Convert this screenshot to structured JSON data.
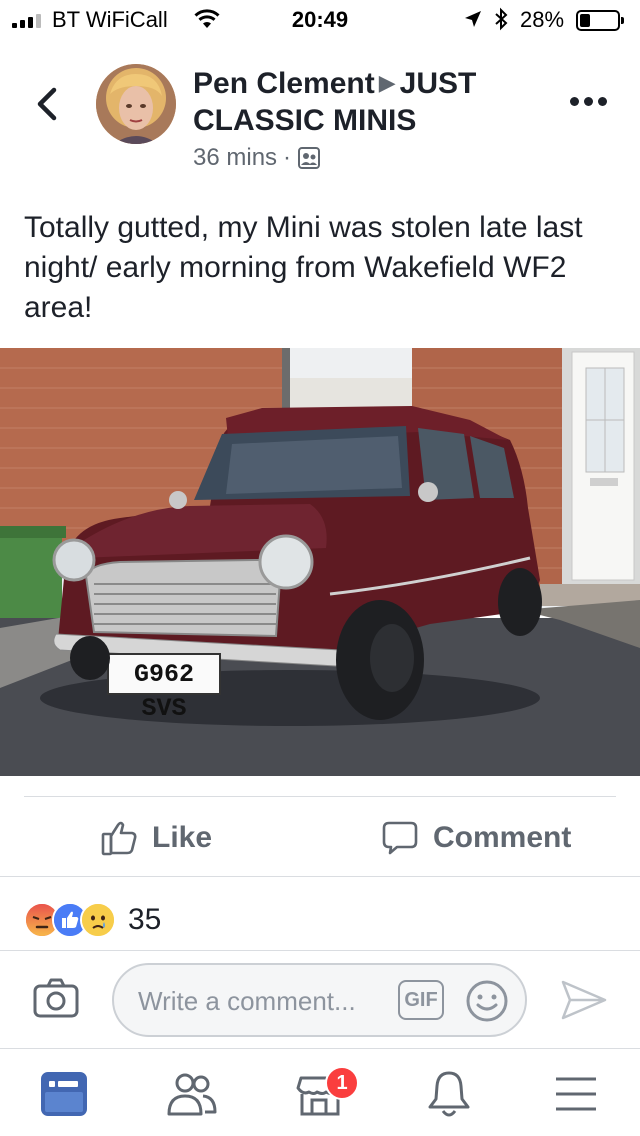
{
  "status_bar": {
    "carrier": "BT WiFiCall",
    "time": "20:49",
    "battery_percent": "28%",
    "battery_level": 0.28
  },
  "header": {
    "back_icon": "chevron-left-icon",
    "author": "Pen Clement",
    "arrow": "▶",
    "group": "JUST CLASSIC MINIS",
    "time_ago": "36 mins",
    "separator": "·",
    "audience_icon": "group-audience-icon",
    "more_icon": "more-horizontal-icon"
  },
  "post": {
    "text": "Totally gutted, my Mini was stolen late last night/ early morning from Wakefield WF2 area!",
    "plate": "G962 SVS"
  },
  "actions": {
    "like_label": "Like",
    "comment_label": "Comment"
  },
  "reactions": {
    "icons": [
      "angry-reaction-icon",
      "like-reaction-icon",
      "sad-reaction-icon"
    ],
    "count": "35"
  },
  "composer": {
    "placeholder": "Write a comment...",
    "gif_label": "GIF"
  },
  "tabbar": {
    "items": [
      "news-feed-icon",
      "friends-icon",
      "marketplace-icon",
      "notifications-icon",
      "menu-icon"
    ],
    "marketplace_badge": "1"
  },
  "colors": {
    "accent": "#4267b2",
    "secondary_text": "#606770",
    "badge": "#fa3e3e"
  }
}
